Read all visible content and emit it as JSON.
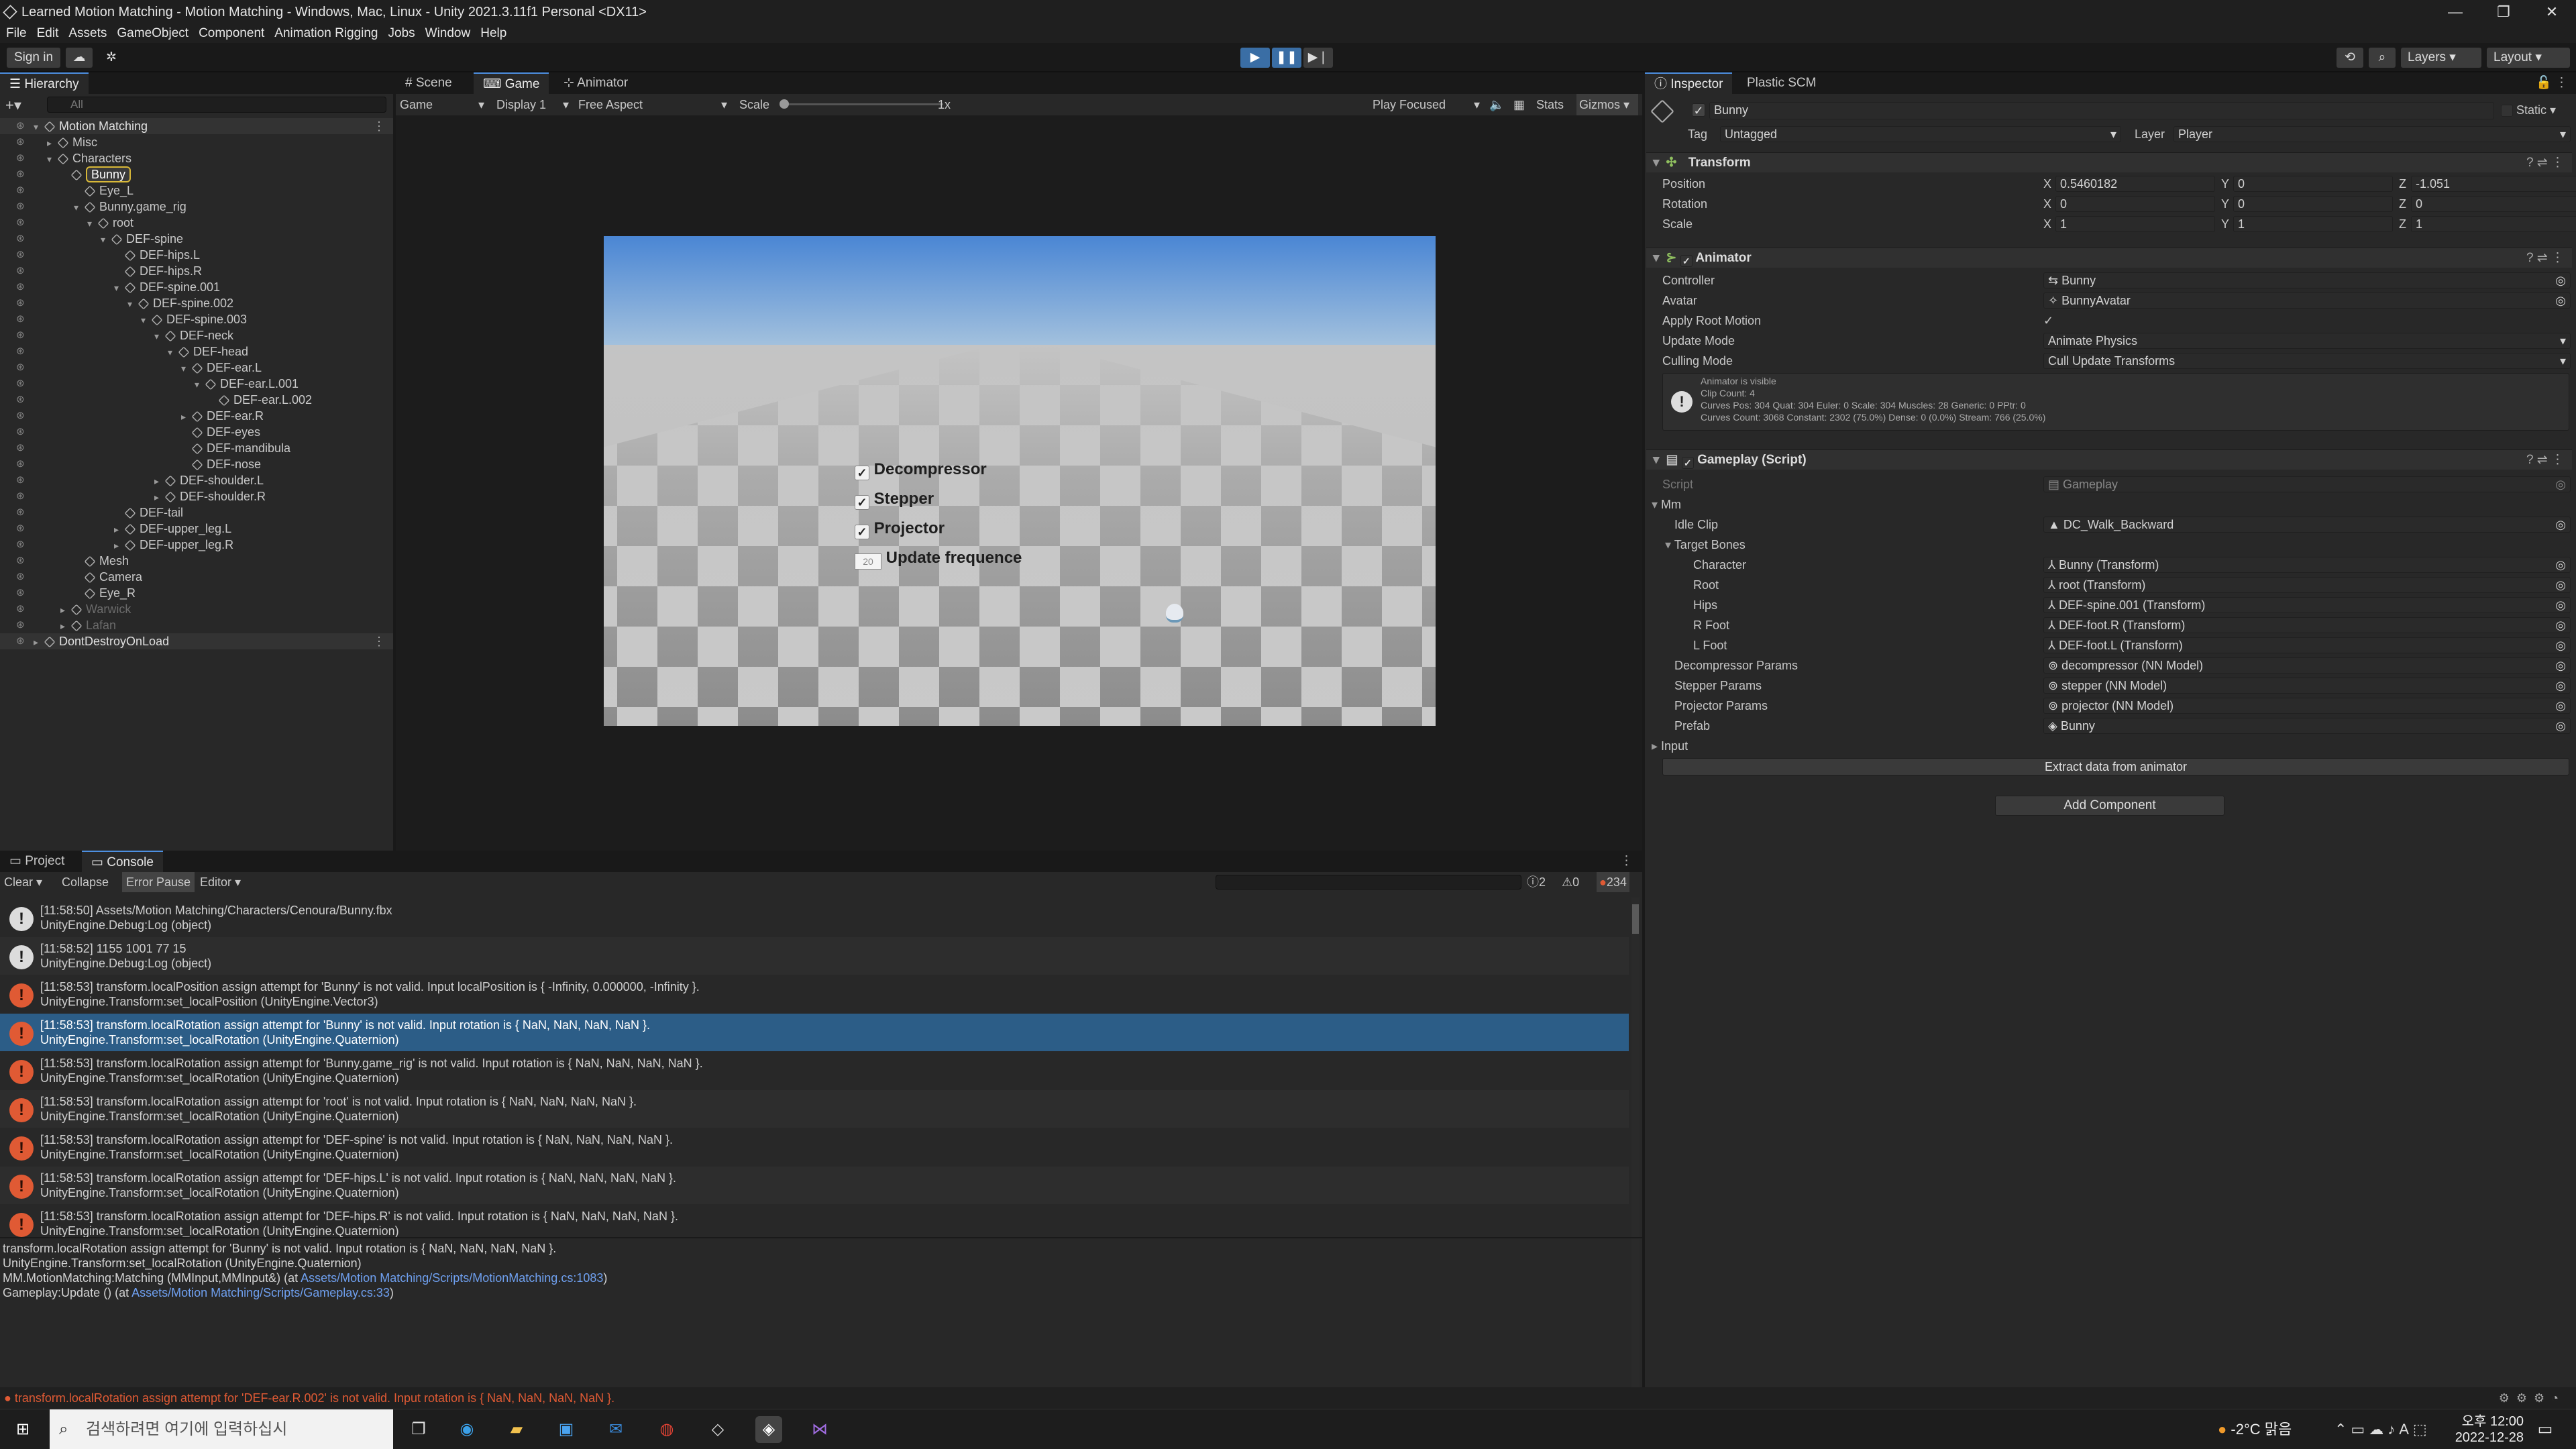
{
  "window": {
    "title": "Learned Motion Matching - Motion Matching - Windows, Mac, Linux - Unity 2021.3.11f1 Personal <DX11>",
    "controls": [
      "—",
      "❐",
      "✕"
    ]
  },
  "menu": [
    "File",
    "Edit",
    "Assets",
    "GameObject",
    "Component",
    "Animation Rigging",
    "Jobs",
    "Window",
    "Help"
  ],
  "toolbar": {
    "sign_in": "Sign in",
    "layers": "Layers",
    "layout": "Layout"
  },
  "hierarchy": {
    "tab": "Hierarchy",
    "search_placeholder": "All",
    "items": [
      {
        "label": "Motion Matching",
        "depth": 0,
        "kind": "scene"
      },
      {
        "label": "Misc",
        "depth": 1
      },
      {
        "label": "Characters",
        "depth": 1
      },
      {
        "label": "Bunny",
        "depth": 2,
        "selected": true
      },
      {
        "label": "Eye_L",
        "depth": 3
      },
      {
        "label": "Bunny.game_rig",
        "depth": 3
      },
      {
        "label": "root",
        "depth": 4
      },
      {
        "label": "DEF-spine",
        "depth": 5
      },
      {
        "label": "DEF-hips.L",
        "depth": 6
      },
      {
        "label": "DEF-hips.R",
        "depth": 6
      },
      {
        "label": "DEF-spine.001",
        "depth": 6
      },
      {
        "label": "DEF-spine.002",
        "depth": 7
      },
      {
        "label": "DEF-spine.003",
        "depth": 8
      },
      {
        "label": "DEF-neck",
        "depth": 9
      },
      {
        "label": "DEF-head",
        "depth": 10
      },
      {
        "label": "DEF-ear.L",
        "depth": 11
      },
      {
        "label": "DEF-ear.L.001",
        "depth": 12
      },
      {
        "label": "DEF-ear.L.002",
        "depth": 13
      },
      {
        "label": "DEF-ear.R",
        "depth": 11
      },
      {
        "label": "DEF-eyes",
        "depth": 11
      },
      {
        "label": "DEF-mandibula",
        "depth": 11
      },
      {
        "label": "DEF-nose",
        "depth": 11
      },
      {
        "label": "DEF-shoulder.L",
        "depth": 9
      },
      {
        "label": "DEF-shoulder.R",
        "depth": 9
      },
      {
        "label": "DEF-tail",
        "depth": 6
      },
      {
        "label": "DEF-upper_leg.L",
        "depth": 6
      },
      {
        "label": "DEF-upper_leg.R",
        "depth": 6
      },
      {
        "label": "Mesh",
        "depth": 3
      },
      {
        "label": "Camera",
        "depth": 3
      },
      {
        "label": "Eye_R",
        "depth": 3
      },
      {
        "label": "Warwick",
        "depth": 2,
        "dim": true
      },
      {
        "label": "Lafan",
        "depth": 2,
        "dim": true
      },
      {
        "label": "DontDestroyOnLoad",
        "depth": 0,
        "kind": "scene"
      }
    ]
  },
  "scene_tabs": [
    "Scene",
    "Game",
    "Animator"
  ],
  "game_bar": {
    "mode": "Game",
    "display": "Display 1",
    "aspect": "Free Aspect",
    "scale_label": "Scale",
    "scale_value": "1x",
    "play_focused": "Play Focused",
    "stats": "Stats",
    "gizmos": "Gizmos"
  },
  "game_ui": {
    "toggles": [
      {
        "label": "Decompressor",
        "checked": true
      },
      {
        "label": "Stepper",
        "checked": true
      },
      {
        "label": "Projector",
        "checked": true
      }
    ],
    "update_value": "20",
    "update_label": "Update frequence"
  },
  "inspector": {
    "tabs": [
      "Inspector",
      "Plastic SCM"
    ],
    "object_name": "Bunny",
    "static_label": "Static",
    "tag_label": "Tag",
    "tag": "Untagged",
    "layer_label": "Layer",
    "layer": "Player",
    "transform": {
      "title": "Transform",
      "rows": [
        {
          "label": "Position",
          "x": "0.5460182",
          "y": "0",
          "z": "-1.051"
        },
        {
          "label": "Rotation",
          "x": "0",
          "y": "0",
          "z": "0"
        },
        {
          "label": "Scale",
          "x": "1",
          "y": "1",
          "z": "1"
        }
      ]
    },
    "animator": {
      "title": "Animator",
      "rows": [
        {
          "label": "Controller",
          "value": "Bunny"
        },
        {
          "label": "Avatar",
          "value": "BunnyAvatar"
        },
        {
          "label": "Apply Root Motion",
          "value": "✓"
        },
        {
          "label": "Update Mode",
          "value": "Animate Physics"
        },
        {
          "label": "Culling Mode",
          "value": "Cull Update Transforms"
        }
      ],
      "info": [
        "Animator is visible",
        "Clip Count: 4",
        "Curves Pos: 304 Quat: 304 Euler: 0 Scale: 304 Muscles: 28 Generic: 0 PPtr: 0",
        "Curves Count: 3068 Constant: 2302 (75.0%) Dense: 0 (0.0%) Stream: 766 (25.0%)"
      ]
    },
    "gameplay": {
      "title": "Gameplay (Script)",
      "script_label": "Script",
      "script_value": "Gameplay",
      "mm_label": "Mm",
      "rows": [
        {
          "label": "Idle Clip",
          "value": "DC_Walk_Backward",
          "indent": 1
        },
        {
          "label": "Target Bones",
          "value": "",
          "indent": 1
        },
        {
          "label": "Character",
          "value": "Bunny (Transform)",
          "indent": 2
        },
        {
          "label": "Root",
          "value": "root (Transform)",
          "indent": 2
        },
        {
          "label": "Hips",
          "value": "DEF-spine.001 (Transform)",
          "indent": 2
        },
        {
          "label": "R Foot",
          "value": "DEF-foot.R (Transform)",
          "indent": 2
        },
        {
          "label": "L Foot",
          "value": "DEF-foot.L (Transform)",
          "indent": 2
        },
        {
          "label": "Decompressor Params",
          "value": "decompressor (NN Model)",
          "indent": 1
        },
        {
          "label": "Stepper Params",
          "value": "stepper (NN Model)",
          "indent": 1
        },
        {
          "label": "Projector Params",
          "value": "projector (NN Model)",
          "indent": 1
        },
        {
          "label": "Prefab",
          "value": "Bunny",
          "indent": 1
        }
      ],
      "input_label": "Input",
      "extract_button": "Extract data from animator"
    },
    "add_component": "Add Component"
  },
  "console": {
    "tabs": [
      "Project",
      "Console"
    ],
    "clear": "Clear",
    "collapse": "Collapse",
    "error_pause": "Error Pause",
    "editor": "Editor",
    "counts": {
      "info": "2",
      "warn": "0",
      "error": "234"
    },
    "logs": [
      {
        "type": "info",
        "l1": "[11:58:50] Assets/Motion Matching/Characters/Cenoura/Bunny.fbx",
        "l2": "UnityEngine.Debug:Log (object)"
      },
      {
        "type": "info",
        "l1": "[11:58:52] 1155 1001 77 15",
        "l2": "UnityEngine.Debug:Log (object)"
      },
      {
        "type": "err",
        "l1": "[11:58:53] transform.localPosition assign attempt for 'Bunny' is not valid. Input localPosition is { -Infinity, 0.000000, -Infinity }.",
        "l2": "UnityEngine.Transform:set_localPosition (UnityEngine.Vector3)"
      },
      {
        "type": "err",
        "l1": "[11:58:53] transform.localRotation assign attempt for 'Bunny' is not valid. Input rotation is { NaN, NaN, NaN, NaN }.",
        "l2": "UnityEngine.Transform:set_localRotation (UnityEngine.Quaternion)",
        "selected": true
      },
      {
        "type": "err",
        "l1": "[11:58:53] transform.localRotation assign attempt for 'Bunny.game_rig' is not valid. Input rotation is { NaN, NaN, NaN, NaN }.",
        "l2": "UnityEngine.Transform:set_localRotation (UnityEngine.Quaternion)"
      },
      {
        "type": "err",
        "l1": "[11:58:53] transform.localRotation assign attempt for 'root' is not valid. Input rotation is { NaN, NaN, NaN, NaN }.",
        "l2": "UnityEngine.Transform:set_localRotation (UnityEngine.Quaternion)"
      },
      {
        "type": "err",
        "l1": "[11:58:53] transform.localRotation assign attempt for 'DEF-spine' is not valid. Input rotation is { NaN, NaN, NaN, NaN }.",
        "l2": "UnityEngine.Transform:set_localRotation (UnityEngine.Quaternion)"
      },
      {
        "type": "err",
        "l1": "[11:58:53] transform.localRotation assign attempt for 'DEF-hips.L' is not valid. Input rotation is { NaN, NaN, NaN, NaN }.",
        "l2": "UnityEngine.Transform:set_localRotation (UnityEngine.Quaternion)"
      },
      {
        "type": "err",
        "l1": "[11:58:53] transform.localRotation assign attempt for 'DEF-hips.R' is not valid. Input rotation is { NaN, NaN, NaN, NaN }.",
        "l2": "UnityEngine.Transform:set_localRotation (UnityEngine.Quaternion)"
      }
    ],
    "detail": [
      "transform.localRotation assign attempt for 'Bunny' is not valid. Input rotation is { NaN, NaN, NaN, NaN }.",
      "UnityEngine.Transform:set_localRotation (UnityEngine.Quaternion)",
      "MM.MotionMatching:Matching (MMInput,MMInput&) (at ",
      "Assets/Motion Matching/Scripts/MotionMatching.cs:1083",
      ")",
      "Gameplay:Update () (at ",
      "Assets/Motion Matching/Scripts/Gameplay.cs:33",
      ")"
    ]
  },
  "status_bar": "transform.localRotation assign attempt for 'DEF-ear.R.002' is not valid. Input rotation is { NaN, NaN, NaN, NaN }.",
  "taskbar": {
    "search_placeholder": "검색하려면 여기에 입력하십시",
    "weather": "-2°C 맑음",
    "time": "오후 12:00",
    "date": "2022-12-28"
  }
}
